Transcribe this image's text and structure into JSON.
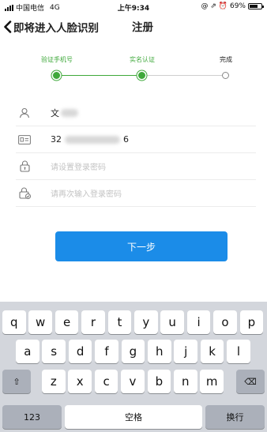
{
  "status_bar": {
    "carrier": "中国电信",
    "network": "4G",
    "time": "上午9:34",
    "icons_right": "@ ⇗ ⏰",
    "battery_percent": "69%",
    "battery_level": 0.69
  },
  "nav": {
    "back_label": "即将进入人脸识别",
    "title": "注册"
  },
  "steps": [
    {
      "label": "验证手机号",
      "state": "complete"
    },
    {
      "label": "实名认证",
      "state": "current"
    },
    {
      "label": "完成",
      "state": "pending"
    }
  ],
  "colors": {
    "accent_green": "#3ea83a",
    "primary_blue": "#1b8ce8",
    "keyboard_bg": "#d3d6dc"
  },
  "form": {
    "name_visible": "文",
    "id_prefix": "32",
    "id_suffix": "6",
    "password_placeholder": "请设置登录密码",
    "confirm_placeholder": "请再次输入登录密码"
  },
  "next_button": "下一步",
  "keyboard": {
    "row1": [
      "q",
      "w",
      "e",
      "r",
      "t",
      "y",
      "u",
      "i",
      "o",
      "p"
    ],
    "row2": [
      "a",
      "s",
      "d",
      "f",
      "g",
      "h",
      "j",
      "k",
      "l"
    ],
    "row3": [
      "z",
      "x",
      "c",
      "v",
      "b",
      "n",
      "m"
    ],
    "shift": "⇧",
    "delete": "⌫",
    "numbers": "123",
    "space": "空格",
    "return": "换行"
  }
}
